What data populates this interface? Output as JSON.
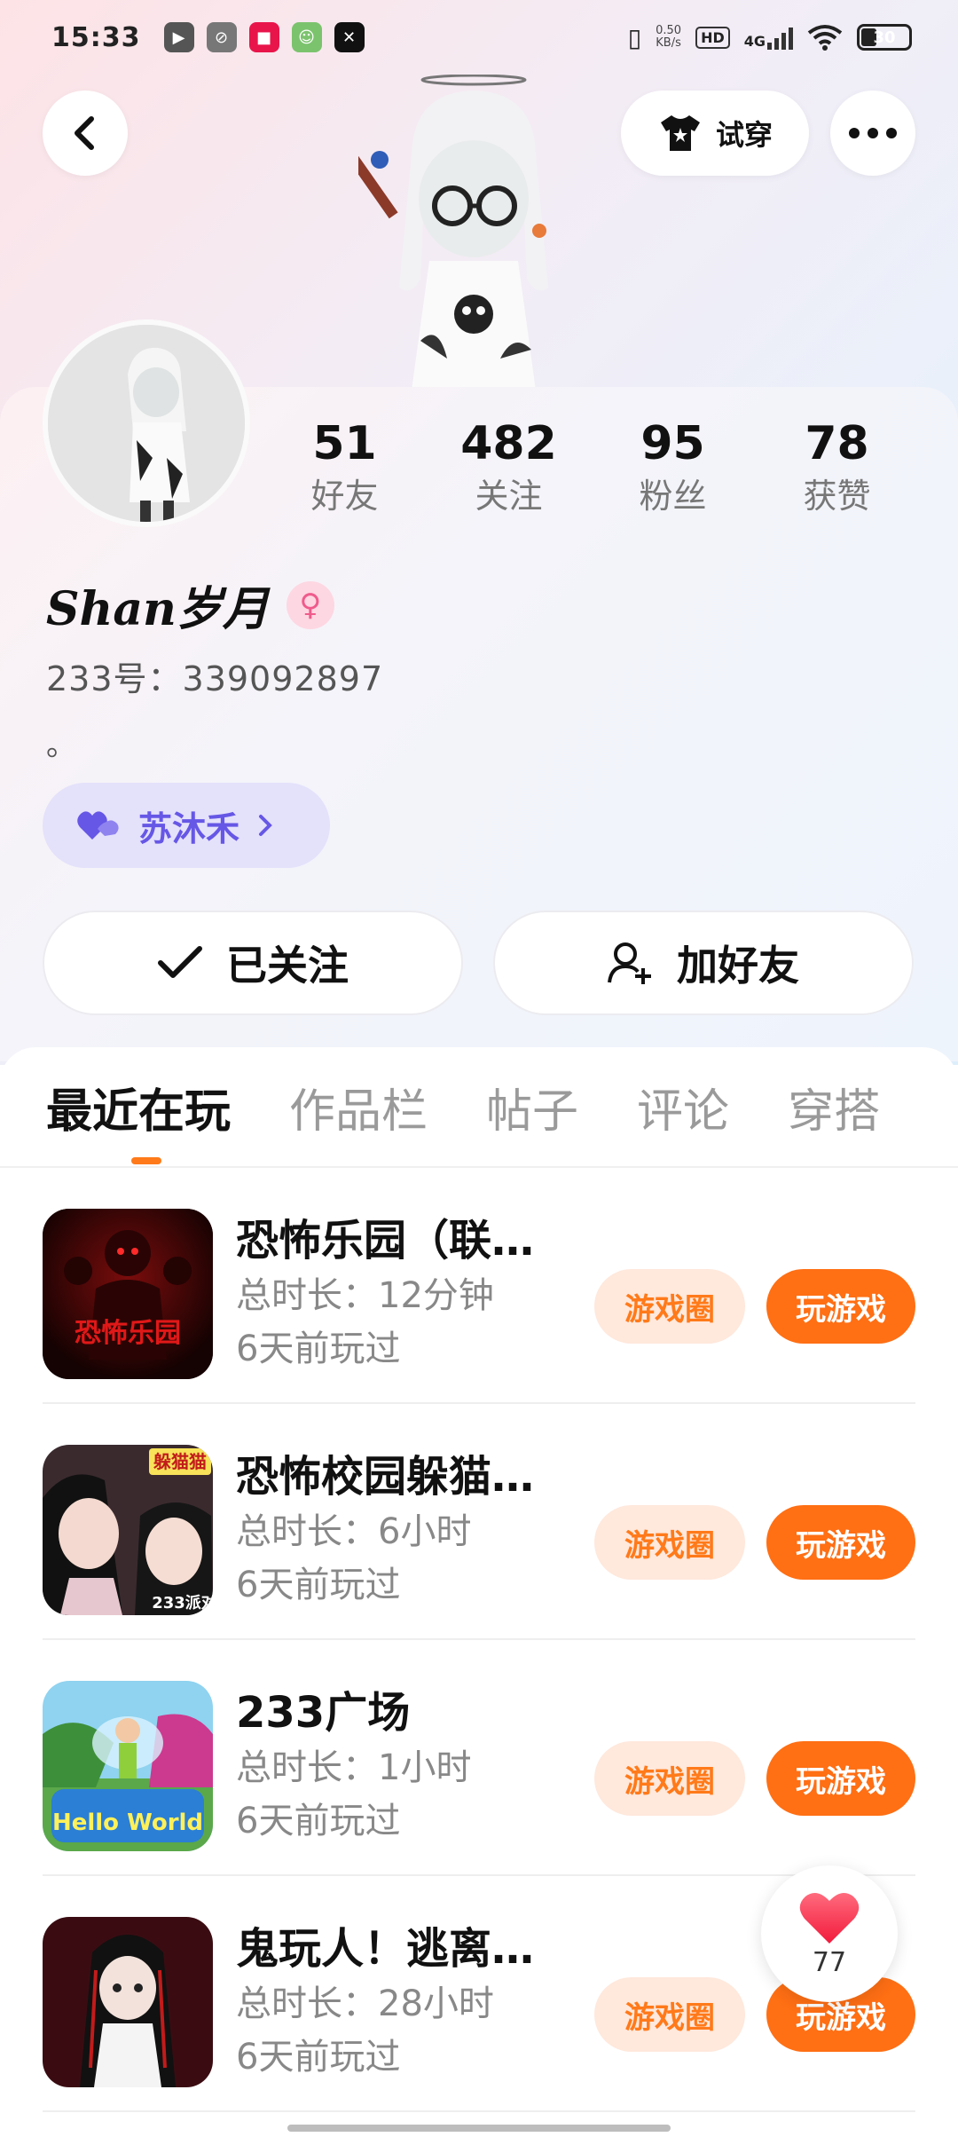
{
  "status_bar": {
    "time": "15:33",
    "net_speed_value": "0.50",
    "net_speed_unit": "KB/s",
    "hd_label": "HD",
    "network_type": "4G",
    "battery_level": "30"
  },
  "header": {
    "try_on_label": "试穿"
  },
  "profile": {
    "nickname": "Shan岁月",
    "gender_symbol": "♀",
    "user_id": "233号：339092897",
    "bio": "。",
    "tag_label": "苏沐禾",
    "stats": [
      {
        "value": "51",
        "label": "好友"
      },
      {
        "value": "482",
        "label": "关注"
      },
      {
        "value": "95",
        "label": "粉丝"
      },
      {
        "value": "78",
        "label": "获赞"
      }
    ],
    "followed_label": "已关注",
    "add_friend_label": "加好友"
  },
  "tabs": [
    {
      "label": "最近在玩",
      "active": true
    },
    {
      "label": "作品栏",
      "active": false
    },
    {
      "label": "帖子",
      "active": false
    },
    {
      "label": "评论",
      "active": false
    },
    {
      "label": "穿搭",
      "active": false
    }
  ],
  "games": [
    {
      "title": "恐怖乐园（联…",
      "duration": "总时长：12分钟",
      "last_played": "6天前玩过",
      "thumb_text": "恐怖乐园",
      "circle_label": "游戏圈",
      "play_label": "玩游戏"
    },
    {
      "title": "恐怖校园躲猫…",
      "duration": "总时长：6小时",
      "last_played": "6天前玩过",
      "thumb_text": "躲猫猫",
      "thumb_text2": "233派对",
      "circle_label": "游戏圈",
      "play_label": "玩游戏"
    },
    {
      "title": "233广场",
      "duration": "总时长：1小时",
      "last_played": "6天前玩过",
      "thumb_text": "Hello World",
      "circle_label": "游戏圈",
      "play_label": "玩游戏"
    },
    {
      "title": "鬼玩人！逃离…",
      "duration": "总时长：28小时",
      "last_played": "6天前玩过",
      "circle_label": "游戏圈",
      "play_label": "玩游戏"
    }
  ],
  "like_fab": {
    "count": "77"
  },
  "colors": {
    "accent": "#ff6f14",
    "accent_soft": "#ffe8dc",
    "tag_bg": "#e4e1fb",
    "tag_text": "#6657e6",
    "gender_pink": "#ef5b8c"
  }
}
